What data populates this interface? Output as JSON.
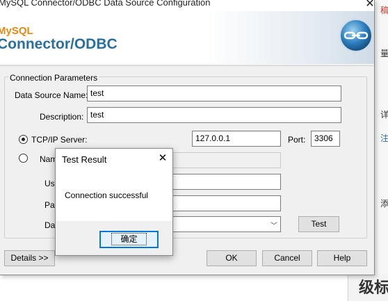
{
  "background": {
    "fragment_1": "稿",
    "fragment_2": "量文",
    "fragment_3": "详",
    "fragment_4": "注",
    "fragment_5": "添",
    "big_text": "级标题"
  },
  "window": {
    "title": "MySQL Connector/ODBC Data Source Configuration",
    "banner_small": "MySQL",
    "banner_big": "Connector/ODBC"
  },
  "params": {
    "group_label": "Connection Parameters",
    "dsn_label": "Data Source Name:",
    "dsn_value": "test",
    "desc_label": "Description:",
    "desc_value": "test",
    "tcp_label": "TCP/IP Server:",
    "server_value": "127.0.0.1",
    "port_label": "Port:",
    "port_value": "3306",
    "named_pipe_label": "Named Pipe:",
    "user_label": "User:",
    "password_label": "Password:",
    "database_label": "Database:",
    "test_button": "Test"
  },
  "footer": {
    "details": "Details >>",
    "ok": "OK",
    "cancel": "Cancel",
    "help": "Help"
  },
  "dialog": {
    "title": "Test Result",
    "message": "Connection successful",
    "ok": "确定"
  }
}
